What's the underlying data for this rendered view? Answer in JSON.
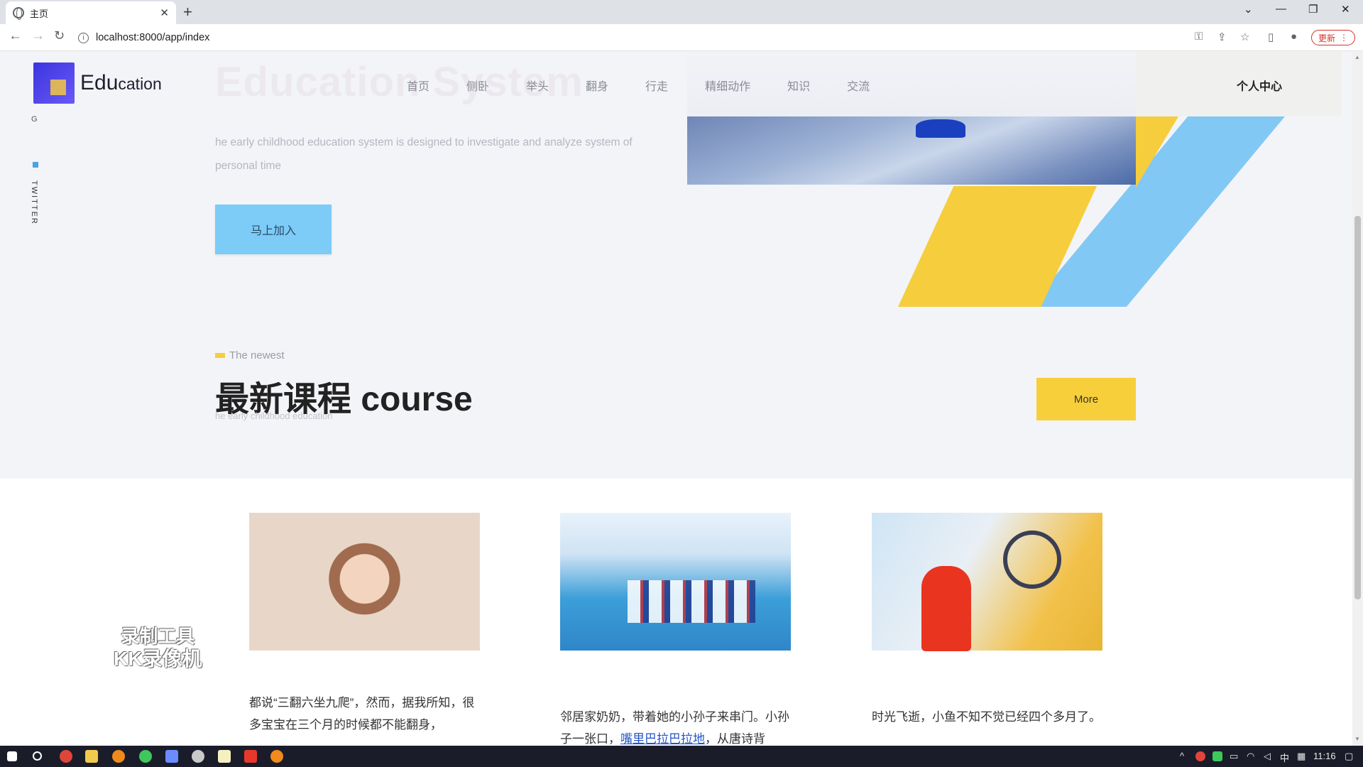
{
  "browser": {
    "tab_title": "主页",
    "new_tab": "+",
    "url": "localhost:8000/app/index",
    "update_label": "更新",
    "window_controls": [
      "⌄",
      "—",
      "❐",
      "✕"
    ]
  },
  "header": {
    "logo_main": "Edu",
    "logo_small": "cation",
    "ghost_title": "Education System",
    "nav": [
      "首页",
      "侧卧",
      "举头",
      "翻身",
      "行走",
      "精细动作",
      "知识",
      "交流"
    ],
    "user_center": "个人中心"
  },
  "side": {
    "social_label": "TWITTER",
    "mark": "G"
  },
  "hero": {
    "description": "he early childhood education system is designed to investigate and analyze system of personal time",
    "join_label": "马上加入"
  },
  "section": {
    "tag": "The newest",
    "title": "最新课程 course",
    "subtitle": "he early childhood education",
    "more_label": "More"
  },
  "courses": [
    {
      "image": "baby-photo",
      "text": "都说“三翻六坐九爬”，然而，据我所知，很多宝宝在三个月的时候都不能翻身，"
    },
    {
      "image": "swim-team-photo",
      "text_a": "邻居家奶奶，带着她的小孙子来串门。小孙子一张口，",
      "text_link": "嘴里巴拉巴拉地",
      "text_b": "，从唐诗背"
    },
    {
      "image": "vlog-photo",
      "text": "时光飞逝，小鱼不知不觉已经四个多月了。"
    }
  ],
  "watermark": {
    "line1": "录制工具",
    "line2": "KK录像机"
  },
  "taskbar": {
    "ime": "中",
    "clock": "11:16"
  }
}
